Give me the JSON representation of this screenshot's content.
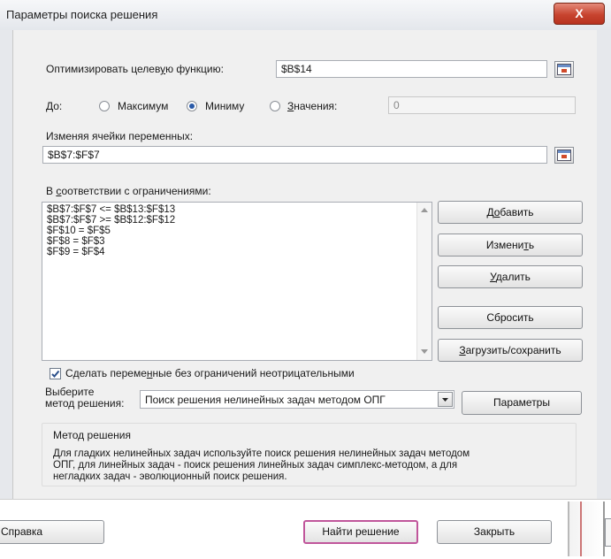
{
  "window": {
    "title": "Параметры поиска решения",
    "close_label": "X"
  },
  "objective": {
    "label_pre": "Оптимизировать целев",
    "label_u": "у",
    "label_post": "ю функцию:",
    "value": "$B$14"
  },
  "to": {
    "label": "До:",
    "options": [
      {
        "label": "Максимум",
        "selected": false
      },
      {
        "label": "Миниму",
        "selected": true
      },
      {
        "label_u": "З",
        "label_post": "начения:",
        "selected": false
      }
    ],
    "value_field": "0"
  },
  "variables": {
    "label": "Изменяя ячейки переменных:",
    "value": "$B$7:$F$7"
  },
  "constraints": {
    "label_pre": "В ",
    "label_u": "с",
    "label_post": "оответствии с ограничениями:",
    "items": [
      "$B$7:$F$7 <= $B$13:$F$13",
      "$B$7:$F$7 >= $B$12:$F$12",
      "$F$10 = $F$5",
      "$F$8 = $F$3",
      "$F$9 = $F$4"
    ]
  },
  "side_buttons": {
    "add": {
      "pre": "Д",
      "u": "о",
      "post": "бавить"
    },
    "change": {
      "pre": "Измени",
      "u": "т",
      "post": "ь"
    },
    "delete": {
      "pre": "",
      "u": "У",
      "post": "далить"
    },
    "reset": "Сбросить",
    "load_save": {
      "pre": "",
      "u": "З",
      "post": "агрузить/сохранить"
    }
  },
  "nonneg": {
    "checked": true,
    "pre": "Сделать переме",
    "u": "н",
    "post": "ные без ограничений неотрицательными"
  },
  "method": {
    "label_line1": "Выберите",
    "label_line2": "метод решения:",
    "selected": "Поиск решения нелинейных задач методом ОПГ",
    "params_button": "Параметры"
  },
  "method_group": {
    "title": "Метод решения",
    "line1": "Для гладких нелинейных задач используйте поиск решения нелинейных задач методом",
    "line2": "ОПГ, для линейных задач - поиск решения линейных задач симплекс-методом, а для",
    "line3": "негладких задач - эволюционный поиск решения."
  },
  "footer": {
    "help": "Справка",
    "solve": "Найти решение",
    "close": "Закрыть"
  },
  "colors": {
    "accent_focus": "#c0569b",
    "close_red": "#c7442f",
    "dialog_bg": "#f0f0f0"
  }
}
